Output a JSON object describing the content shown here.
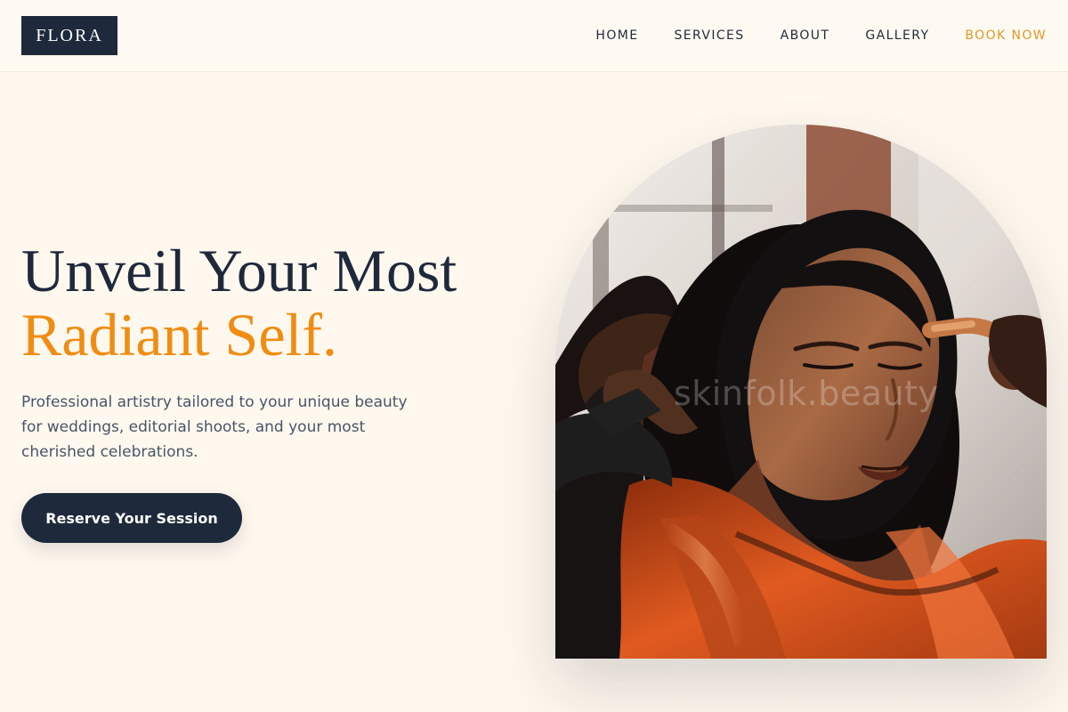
{
  "brand": {
    "logo_text": "FLORA"
  },
  "nav": {
    "items": [
      {
        "label": "HOME"
      },
      {
        "label": "SERVICES"
      },
      {
        "label": "ABOUT"
      },
      {
        "label": "GALLERY"
      }
    ],
    "cta": {
      "label": "BOOK NOW"
    }
  },
  "hero": {
    "title_line1": "Unveil Your Most",
    "title_line2": "Radiant Self.",
    "description": "Professional artistry tailored to your unique beauty for weddings, editorial shoots, and your most cherished celebrations.",
    "button_label": "Reserve Your Session"
  },
  "image": {
    "watermark": "skinfolk.beauty"
  },
  "colors": {
    "navy": "#1e293b",
    "accent": "#f18c13",
    "nav_accent": "#e0972a",
    "background": "#fff8ee"
  }
}
